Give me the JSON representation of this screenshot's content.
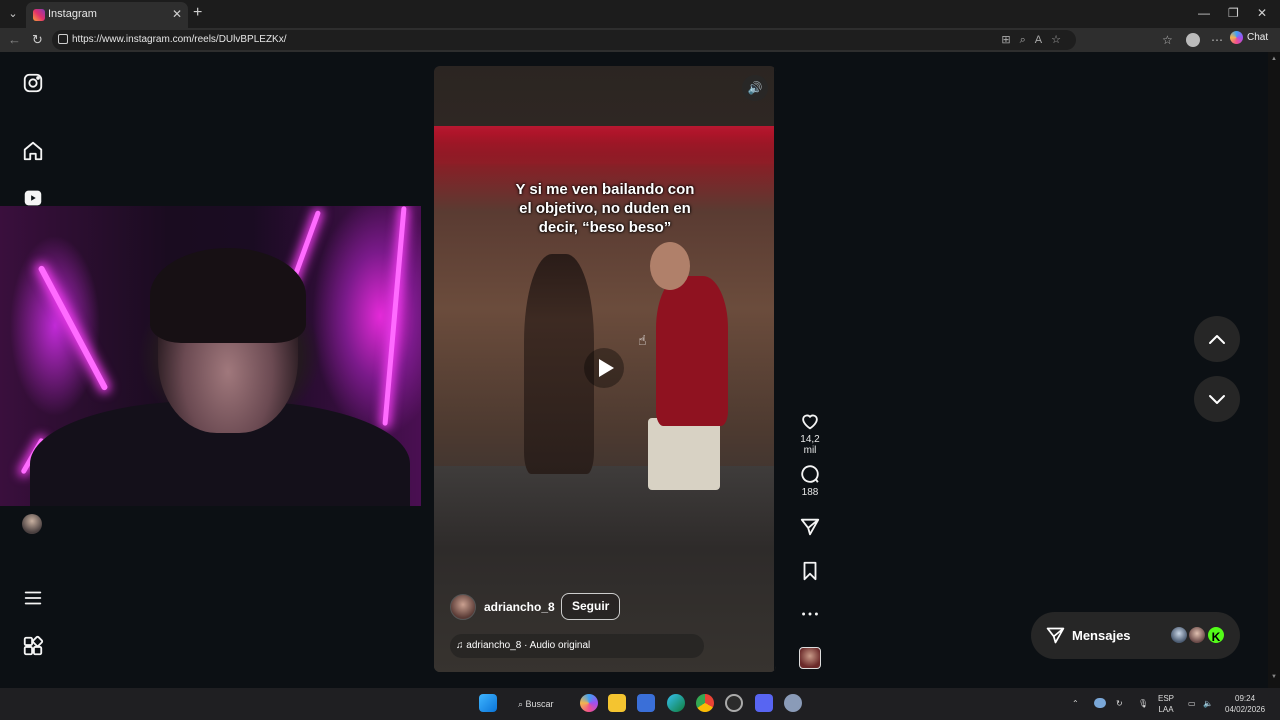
{
  "browser": {
    "tab_title": "Instagram",
    "url": "https://www.instagram.com/reels/DUlvBPLEZKx/",
    "chat_label": "Chat"
  },
  "reel": {
    "caption_line1": "Y si me ven bailando con",
    "caption_line2": "el objetivo, no duden en",
    "caption_line3": "decir, “beso beso”",
    "author": "adriancho_8",
    "follow_label": "Seguir",
    "audio": "adriancho_8 · Audio original"
  },
  "actions": {
    "likes": "14,2 mil",
    "comments": "188"
  },
  "messages": {
    "label": "Mensajes",
    "badge": "K"
  },
  "taskbar": {
    "search_label": "Buscar",
    "lang_line1": "ESP",
    "lang_line2": "LAA",
    "time": "09:24",
    "date": "04/02/2026"
  },
  "colors": {
    "page_bg": "#0c1014",
    "accent_badge": "#53fc18"
  }
}
